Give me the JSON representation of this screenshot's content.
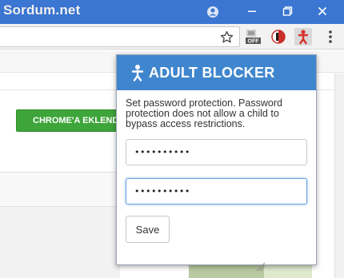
{
  "window": {
    "brand_label": "Sordum.net"
  },
  "toolbar": {
    "extensions": [
      {
        "name": "off-extension-icon",
        "label": "OFF"
      },
      {
        "name": "shield-extension-icon",
        "label": ""
      },
      {
        "name": "adult-blocker-extension-icon",
        "label": ""
      }
    ]
  },
  "page": {
    "add_to_chrome_label": "CHROME'A EKLENDİ"
  },
  "popup": {
    "title": "ADULT BLOCKER",
    "description": "Set password protection. Password protection does not allow a child to bypass access restrictions.",
    "password_value": "••••••••••",
    "confirm_password_value": "••••••••••",
    "save_label": "Save"
  },
  "colors": {
    "titlebar": "#3b76d3",
    "popup_header": "#3f86ce",
    "add_button": "#3ea53a"
  }
}
